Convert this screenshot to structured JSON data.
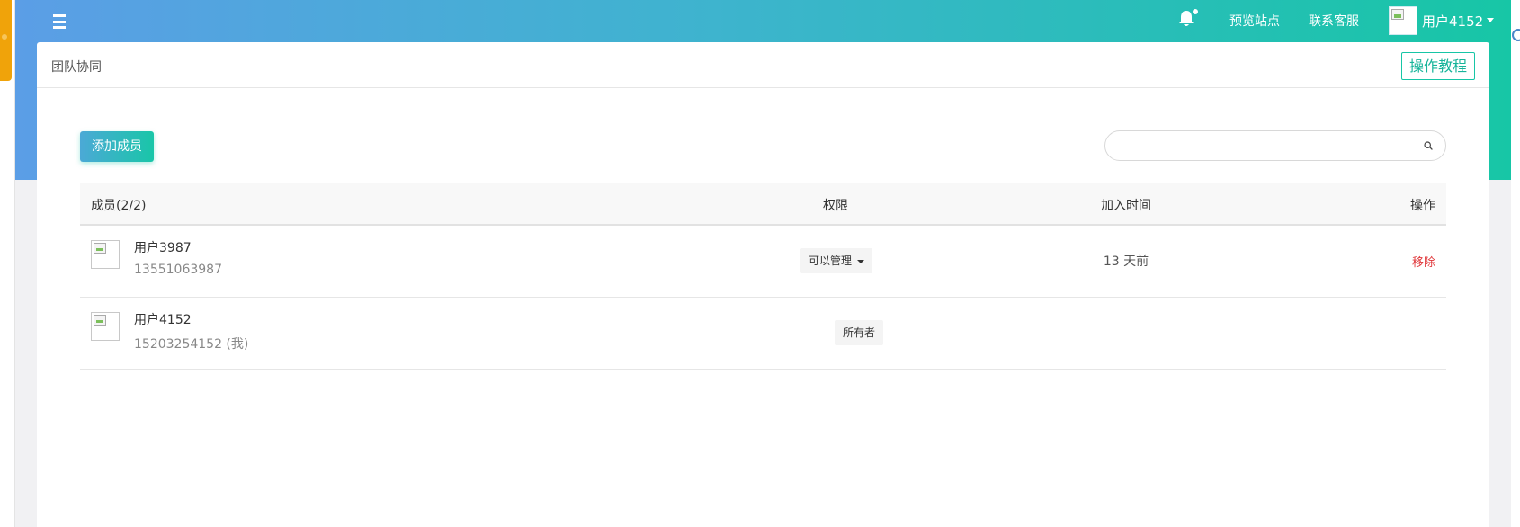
{
  "side_tab": {
    "label": "…"
  },
  "header": {
    "nav": {
      "preview_site": "预览站点",
      "contact_support": "联系客服"
    },
    "user": {
      "name": "用户4152"
    }
  },
  "panel": {
    "title": "团队协同",
    "tutorial_label": "操作教程",
    "add_member_label": "添加成员",
    "search": {
      "placeholder": "",
      "value": ""
    }
  },
  "table": {
    "columns": {
      "member": "成员(2/2)",
      "permission": "权限",
      "joined": "加入时间",
      "action": "操作"
    },
    "rows": [
      {
        "name": "用户3987",
        "phone": "13551063987",
        "permission": "可以管理",
        "joined": "13 天前",
        "action": "移除"
      },
      {
        "name": "用户4152",
        "phone": "15203254152 (我)",
        "permission": "所有者",
        "joined": "",
        "action": ""
      }
    ]
  },
  "colors": {
    "brand_start": "#5b9ee6",
    "brand_end": "#17c6a6",
    "danger": "#e0373a"
  }
}
